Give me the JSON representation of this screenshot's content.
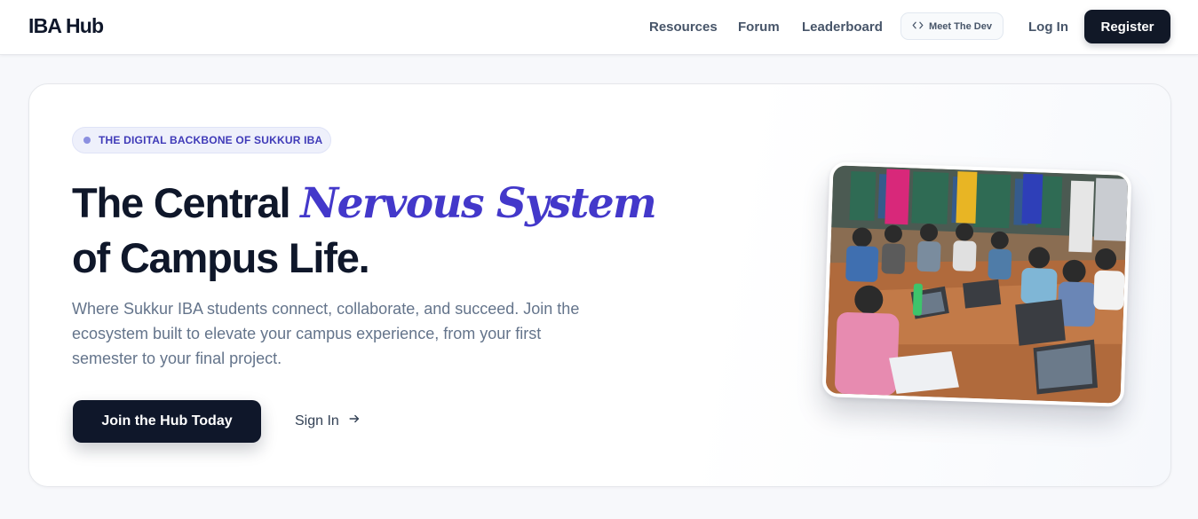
{
  "brand": {
    "name": "IBA Hub"
  },
  "nav": {
    "resources": "Resources",
    "forum": "Forum",
    "leaderboard": "Leaderboard",
    "meet_dev": "Meet The Dev",
    "login": "Log In",
    "register": "Register"
  },
  "hero": {
    "badge": "THE DIGITAL BACKBONE OF SUKKUR IBA",
    "headline_part1": "The Central ",
    "headline_accent": "Nervous System",
    "headline_part2": "of Campus Life.",
    "subtext": "Where Sukkur IBA students connect, collaborate, and succeed. Join the ecosystem built to elevate your campus experience, from your first semester to your final project.",
    "primary_cta": "Join the Hub Today",
    "secondary_cta": "Sign In"
  },
  "icons": {
    "meet_dev": "code-icon",
    "sign_in": "arrow-right-icon"
  },
  "colors": {
    "accent": "#4338ca",
    "dark": "#0f172a",
    "muted_text": "#64748b"
  }
}
